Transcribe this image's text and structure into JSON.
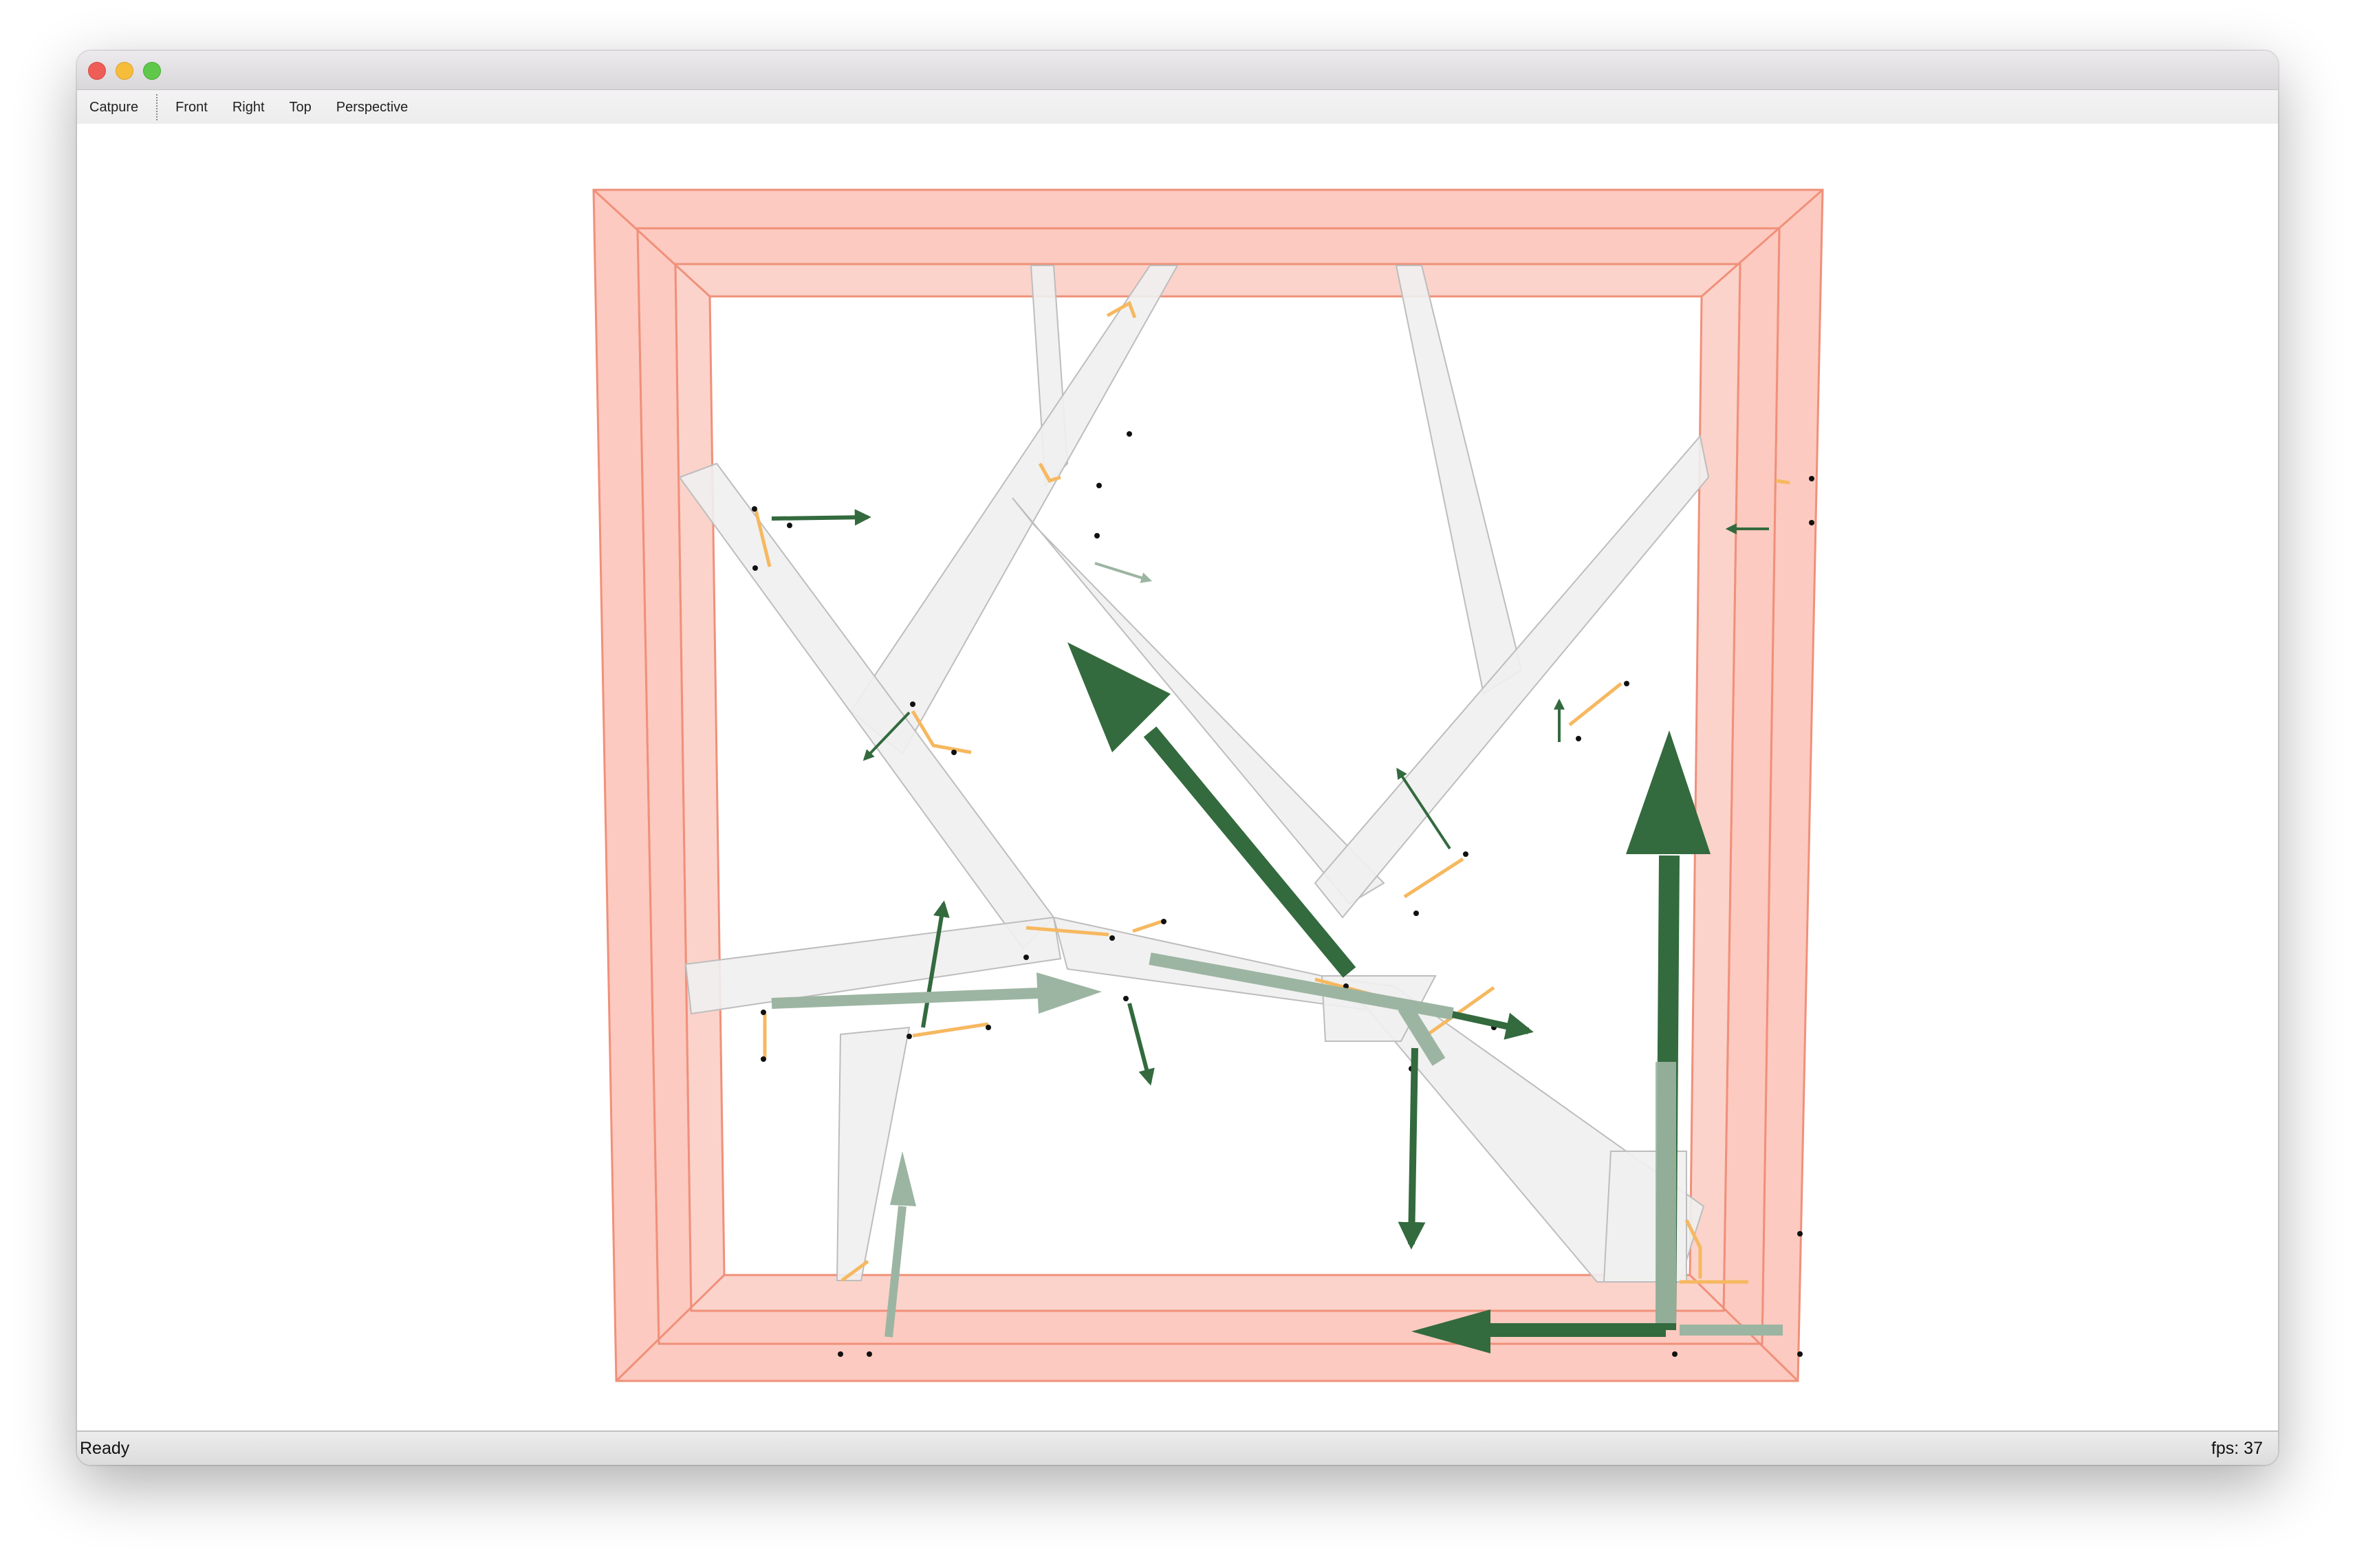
{
  "window": {
    "traffic_lights": [
      "close",
      "minimize",
      "maximize"
    ]
  },
  "toolbar": {
    "capture_label": "Catpure",
    "front_label": "Front",
    "right_label": "Right",
    "top_label": "Top",
    "perspective_label": "Perspective"
  },
  "scene": {
    "frame_color": "#fccac0",
    "frame_edge_color": "#f0907a",
    "member_color": "#eeeeee",
    "member_edge_color": "#bdbdbd",
    "support_color": "#f6b860",
    "arrow_color": "#336a3e",
    "arrow_faded_color": "#9cb5a2",
    "node_color": "#111111"
  },
  "status": {
    "message": "Ready",
    "fps": "fps: 37"
  }
}
